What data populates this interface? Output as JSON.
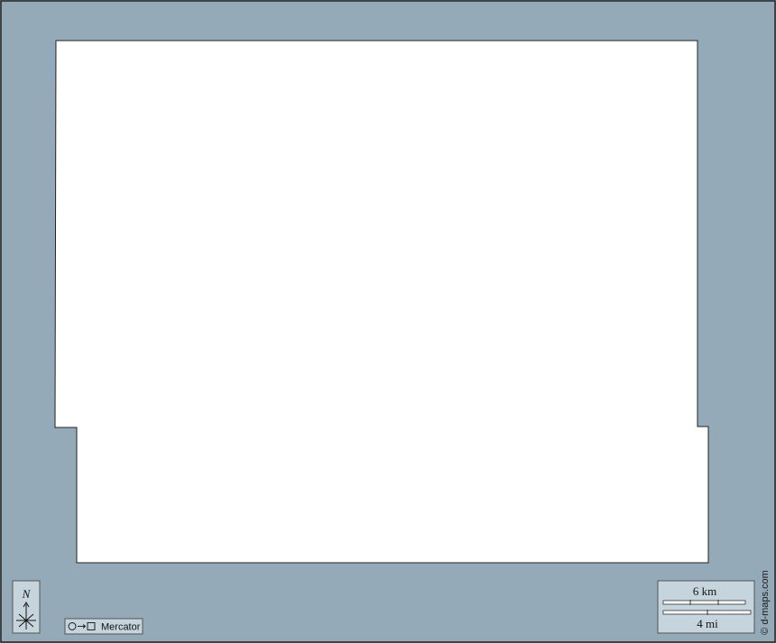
{
  "map": {
    "background_color": "#94aab8",
    "land_color": "#ffffff",
    "panel_color": "#c6d5dd",
    "border_color": "#222222"
  },
  "north_arrow": {
    "label": "N"
  },
  "projection": {
    "label": "Mercator",
    "icon": "circle-to-square-icon"
  },
  "scale_bar": {
    "km_label": "6 km",
    "mi_label": "4 mi"
  },
  "credit": {
    "text": "© d-maps.com"
  }
}
